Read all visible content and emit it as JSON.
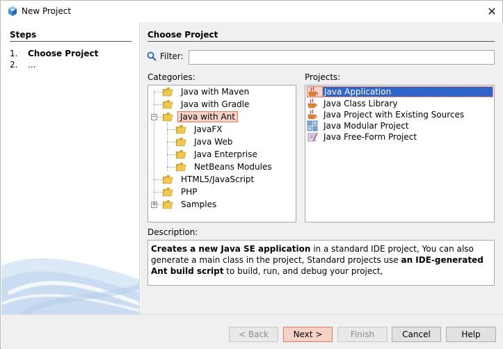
{
  "window": {
    "title": "New Project",
    "close_glyph": "✕"
  },
  "steps": {
    "title": "Steps",
    "items": [
      {
        "num": "1.",
        "label": "Choose Project",
        "current": true
      },
      {
        "num": "2.",
        "label": "...",
        "current": false
      }
    ]
  },
  "main": {
    "section_title": "Choose Project",
    "filter_label": "Filter:",
    "filter_value": "",
    "categories_label": "Categories:",
    "projects_label": "Projects:",
    "categories": [
      {
        "label": "Java with Maven"
      },
      {
        "label": "Java with Gradle"
      },
      {
        "label": "Java with Ant"
      },
      {
        "label": "JavaFX"
      },
      {
        "label": "Java Web"
      },
      {
        "label": "Java Enterprise"
      },
      {
        "label": "NetBeans Modules"
      },
      {
        "label": "HTML5/JavaScript"
      },
      {
        "label": "PHP"
      },
      {
        "label": "Samples"
      }
    ],
    "projects": [
      {
        "label": "Java Application",
        "icon": "java-cup-icon"
      },
      {
        "label": "Java Class Library",
        "icon": "java-cup-icon"
      },
      {
        "label": "Java Project with Existing Sources",
        "icon": "java-cup-icon"
      },
      {
        "label": "Java Modular Project",
        "icon": "modular-project-icon"
      },
      {
        "label": "Java Free-Form Project",
        "icon": "free-form-project-icon"
      }
    ],
    "description_label": "Description:",
    "description": {
      "p1_bold": "Creates a new Java SE application",
      "p1_rest": " in a standard IDE project, You can also generate a main class in the project, Standard projects use ",
      "p2_bold": "an IDE-generated Ant build script",
      "p2_rest": " to build, run, and debug your project,"
    }
  },
  "buttons": {
    "back": "< Back",
    "next": "Next >",
    "finish": "Finish",
    "cancel": "Cancel",
    "help": "Help"
  },
  "colors": {
    "selection_blue": "#2f65ca",
    "highlight_fill": "#f7d3c7",
    "highlight_border": "#e07a5f",
    "folder_yellow": "#f1c84b"
  }
}
